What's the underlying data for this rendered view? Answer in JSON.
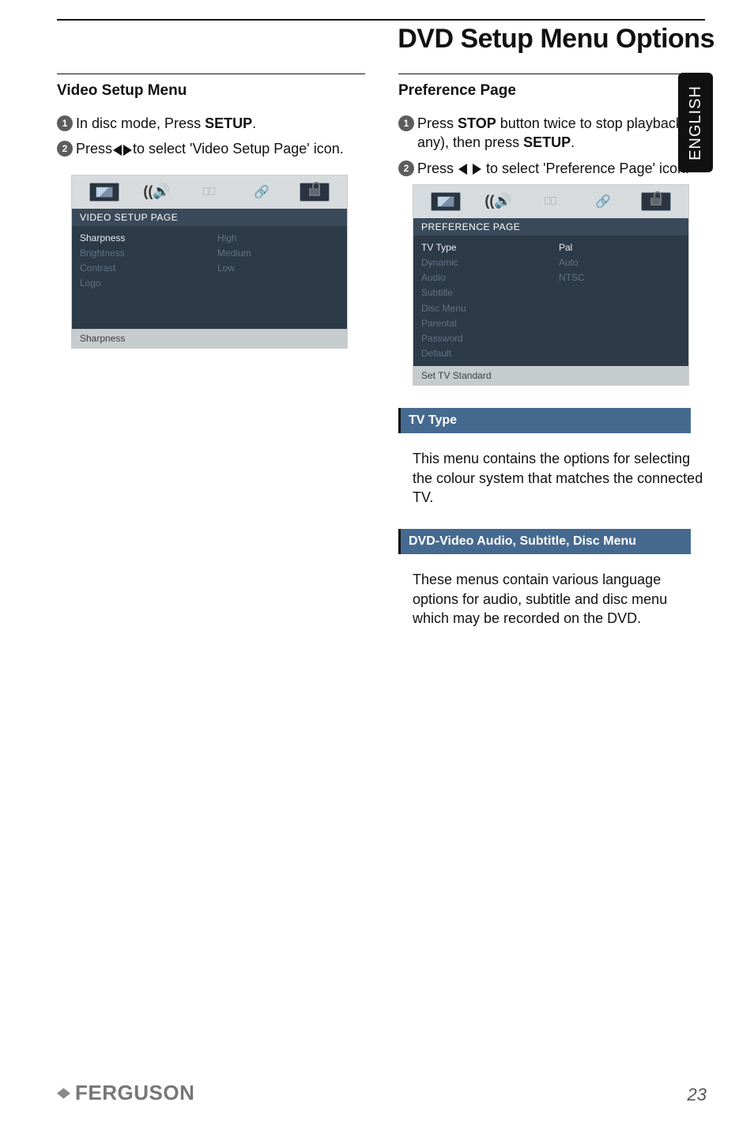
{
  "page_title": "DVD Setup Menu Options",
  "side_tab": "ENGLISH",
  "left": {
    "heading": "Video Setup Menu",
    "step1_pre": "In disc mode, Press ",
    "step1_bold": "SETUP",
    "step1_post": ".",
    "step2_pre": "Press",
    "step2_post": "to select 'Video Setup Page' icon.",
    "osd": {
      "title": "VIDEO SETUP PAGE",
      "menu": [
        "Sharpness",
        "Brightness",
        "Contrast",
        "Logo"
      ],
      "menu_active_index": 0,
      "options": [
        "High",
        "Medium",
        "Low"
      ],
      "status": "Sharpness"
    }
  },
  "right": {
    "heading": "Preference Page",
    "step1_pre": "Press ",
    "step1_bold": "STOP",
    "step1_mid": " button twice to stop playback (if any), then press ",
    "step1_bold2": "SETUP",
    "step1_post": ".",
    "step2_pre": "Press ",
    "step2_post": " to select 'Preference Page' icon.",
    "osd": {
      "title": "PREFERENCE PAGE",
      "menu": [
        "TV Type",
        "Dynamic",
        "Audio",
        "Subtitle",
        "Disc Menu",
        "Parental",
        "Password",
        "Default"
      ],
      "menu_active_index": 0,
      "options": [
        "Pal",
        "Auto",
        "NTSC"
      ],
      "options_active_index": 0,
      "status": "Set TV Standard"
    },
    "sub1_head": "TV Type",
    "sub1_para": "This menu contains the options for selecting the colour system that matches the connected TV.",
    "sub2_head": "DVD-Video Audio, Subtitle, Disc Menu",
    "sub2_para": "These menus contain various language options for audio, subtitle and disc menu which may be recorded on the DVD."
  },
  "footer": {
    "brand": "FERGUSON",
    "page_number": "23"
  },
  "badges": {
    "one": "1",
    "two": "2"
  }
}
